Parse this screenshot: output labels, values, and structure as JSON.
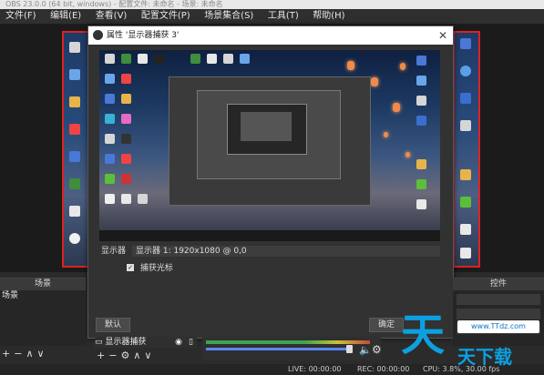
{
  "window": {
    "title": "OBS 23.0.0 (64 bit, windows) - 配置文件: 未命名 - 场景: 未命名"
  },
  "menu": [
    "文件(F)",
    "编辑(E)",
    "查看(V)",
    "配置文件(P)",
    "场景集合(S)",
    "工具(T)",
    "帮助(H)"
  ],
  "dialog": {
    "title": "属性 '显示器捕获 3'",
    "display_label": "显示器",
    "display_value": "显示器 1: 1920x1080 @ 0,0",
    "capture_cursor_label": "捕获光标",
    "capture_cursor_checked": true,
    "defaults_label": "默认",
    "ok_label": "确定"
  },
  "docks": {
    "scenes_title": "场景",
    "scenes_items": [
      "场景"
    ],
    "controls_title": "控件"
  },
  "sources": {
    "items": [
      "显示器捕获"
    ]
  },
  "status": {
    "live": "LIVE: 00:00:00",
    "rec": "REC: 00:00:00",
    "cpu": "CPU: 3.8%, 30.00 fps"
  },
  "watermark": {
    "big": "天",
    "url": "www.TTdz.com",
    "small": "天下载"
  },
  "colors": {
    "accent": "#d22222",
    "brand": "#0ca0e0"
  }
}
